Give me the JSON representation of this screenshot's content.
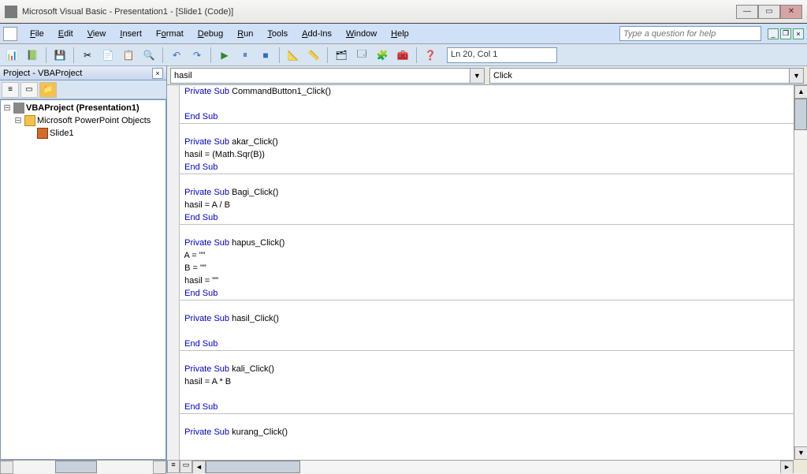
{
  "window": {
    "title": "Microsoft Visual Basic - Presentation1 - [Slide1 (Code)]"
  },
  "menus": {
    "file": "File",
    "edit": "Edit",
    "view": "View",
    "insert": "Insert",
    "format": "Format",
    "debug": "Debug",
    "run": "Run",
    "tools": "Tools",
    "addins": "Add-Ins",
    "window": "Window",
    "help": "Help"
  },
  "help_search_placeholder": "Type a question for help",
  "toolbar_icons": {
    "ppt": "📊",
    "excel": "📗",
    "save": "💾",
    "cut": "✂",
    "copy": "📄",
    "paste": "📋",
    "find": "🔍",
    "undo": "↶",
    "redo": "↷",
    "run": "▶",
    "pause": "⏸",
    "stop": "■",
    "design": "📐",
    "ruler": "📏",
    "proj": "🗂",
    "prop": "🗔",
    "obj": "🧩",
    "tbx": "🧰",
    "help": "❓"
  },
  "status": {
    "position": "Ln 20, Col 1"
  },
  "project": {
    "title": "Project - VBAProject",
    "root": "VBAProject (Presentation1)",
    "folder": "Microsoft PowerPoint Objects",
    "slide": "Slide1"
  },
  "code_dropdowns": {
    "object": "hasil",
    "procedure": "Click"
  },
  "code_lines": [
    {
      "t": "Private Sub CommandButton1_Click()",
      "k": true,
      "ind": 1
    },
    {
      "t": "",
      "k": false,
      "ind": 1
    },
    {
      "t": "End Sub",
      "k": true,
      "ind": 1,
      "hr": true
    },
    {
      "t": "",
      "k": false,
      "ind": 0,
      "skip": true
    },
    {
      "t": "Private Sub akar_Click()",
      "k": true,
      "ind": 1
    },
    {
      "t": "hasil = (Math.Sqr(B))",
      "k": false,
      "ind": 1
    },
    {
      "t": "End Sub",
      "k": true,
      "ind": 1,
      "hr": true
    },
    {
      "t": "",
      "k": false,
      "ind": 0,
      "skip": true
    },
    {
      "t": "Private Sub Bagi_Click()",
      "k": true,
      "ind": 1
    },
    {
      "t": "hasil = A / B",
      "k": false,
      "ind": 1
    },
    {
      "t": "End Sub",
      "k": true,
      "ind": 1,
      "hr": true
    },
    {
      "t": "",
      "k": false,
      "ind": 0,
      "skip": true
    },
    {
      "t": "Private Sub hapus_Click()",
      "k": true,
      "ind": 1
    },
    {
      "t": "A = \"\"",
      "k": false,
      "ind": 1
    },
    {
      "t": "B = \"\"",
      "k": false,
      "ind": 1
    },
    {
      "t": "hasil = \"\"",
      "k": false,
      "ind": 1
    },
    {
      "t": "End Sub",
      "k": true,
      "ind": 1,
      "hr": true
    },
    {
      "t": "",
      "k": false,
      "ind": 0,
      "skip": true
    },
    {
      "t": "Private Sub hasil_Click()",
      "k": true,
      "ind": 1
    },
    {
      "t": "",
      "k": false,
      "ind": 1
    },
    {
      "t": "End Sub",
      "k": true,
      "ind": 1,
      "hr": true
    },
    {
      "t": "",
      "k": false,
      "ind": 0,
      "skip": true
    },
    {
      "t": "Private Sub kali_Click()",
      "k": true,
      "ind": 1
    },
    {
      "t": "hasil = A * B",
      "k": false,
      "ind": 1
    },
    {
      "t": "",
      "k": false,
      "ind": 1
    },
    {
      "t": "End Sub",
      "k": true,
      "ind": 1,
      "hr": true
    },
    {
      "t": "",
      "k": false,
      "ind": 0,
      "skip": true
    },
    {
      "t": "Private Sub kurang_Click()",
      "k": true,
      "ind": 1
    }
  ]
}
